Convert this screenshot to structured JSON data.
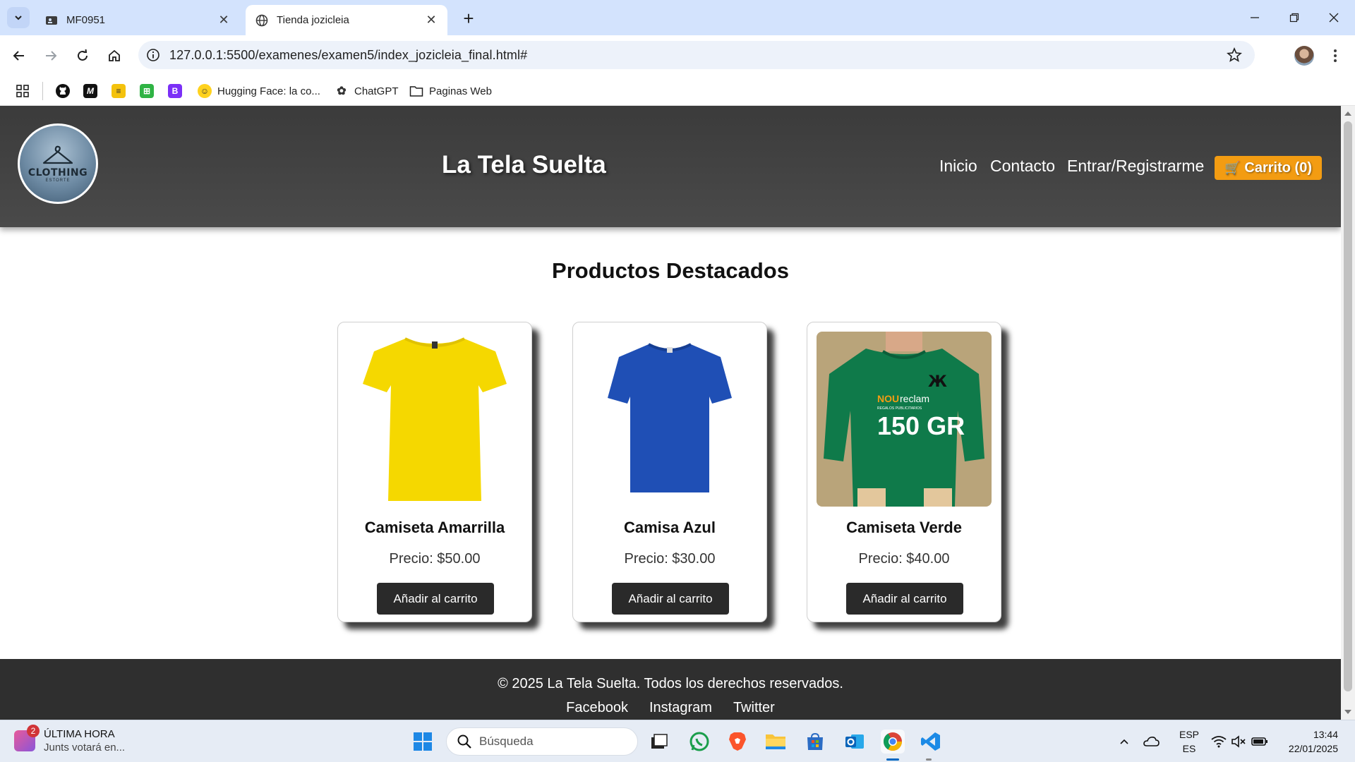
{
  "browser": {
    "tabs": [
      {
        "title": "MF0951",
        "active": false,
        "icon": "profile-card-icon"
      },
      {
        "title": "Tienda jozicleia",
        "active": true,
        "icon": "globe-icon"
      }
    ],
    "url": "127.0.0.1:5500/examenes/examen5/index_jozicleia_final.html#",
    "bookmarks": [
      {
        "label": "",
        "icon": "apps-grid-icon"
      },
      {
        "label": "",
        "icon": "github-icon"
      },
      {
        "label": "",
        "icon": "m-icon"
      },
      {
        "label": "",
        "icon": "stack-icon"
      },
      {
        "label": "",
        "icon": "green-app-icon"
      },
      {
        "label": "",
        "icon": "bootstrap-icon"
      },
      {
        "label": "Hugging Face: la co...",
        "icon": "hugging-face-icon"
      },
      {
        "label": "ChatGPT",
        "icon": "chatgpt-icon"
      },
      {
        "label": "Paginas Web",
        "icon": "folder-icon"
      }
    ]
  },
  "site": {
    "logo": {
      "word": "CLOTHING",
      "sub": "ESTORTE"
    },
    "title": "La Tela Suelta",
    "nav": [
      "Inicio",
      "Contacto",
      "Entrar/Registrarme"
    ],
    "cart_label": "Carrito (0)",
    "section_title": "Productos Destacados",
    "products": [
      {
        "name": "Camiseta Amarrilla",
        "price": "Precio: $50.00",
        "button": "Añadir al carrito",
        "color": "#f5d800"
      },
      {
        "name": "Camisa Azul",
        "price": "Precio: $30.00",
        "button": "Añadir al carrito",
        "color": "#1f4fb5"
      },
      {
        "name": "Camiseta Verde",
        "price": "Precio: $40.00",
        "button": "Añadir al carrito",
        "color": "#0f7a4a",
        "print_brand_a": "NOU",
        "print_brand_b": "reclam",
        "print_tag": "REGALOS PUBLICITARIOS",
        "print_weight": "150 GR"
      }
    ],
    "footer": {
      "copyright": "© 2025 La Tela Suelta. Todos los derechos reservados.",
      "links": [
        "Facebook",
        "Instagram",
        "Twitter"
      ]
    }
  },
  "taskbar": {
    "news_badge": "2",
    "news_title": "ÚLTIMA HORA",
    "news_sub": "Junts votará en...",
    "search_placeholder": "Búsqueda",
    "lang_1": "ESP",
    "lang_2": "ES",
    "time": "13:44",
    "date": "22/01/2025"
  },
  "colors": {
    "header_bg": "#404040",
    "cart_orange": "#f39c12",
    "button_dark": "#2a2a2a",
    "footer_bg": "#2f2f2f"
  }
}
